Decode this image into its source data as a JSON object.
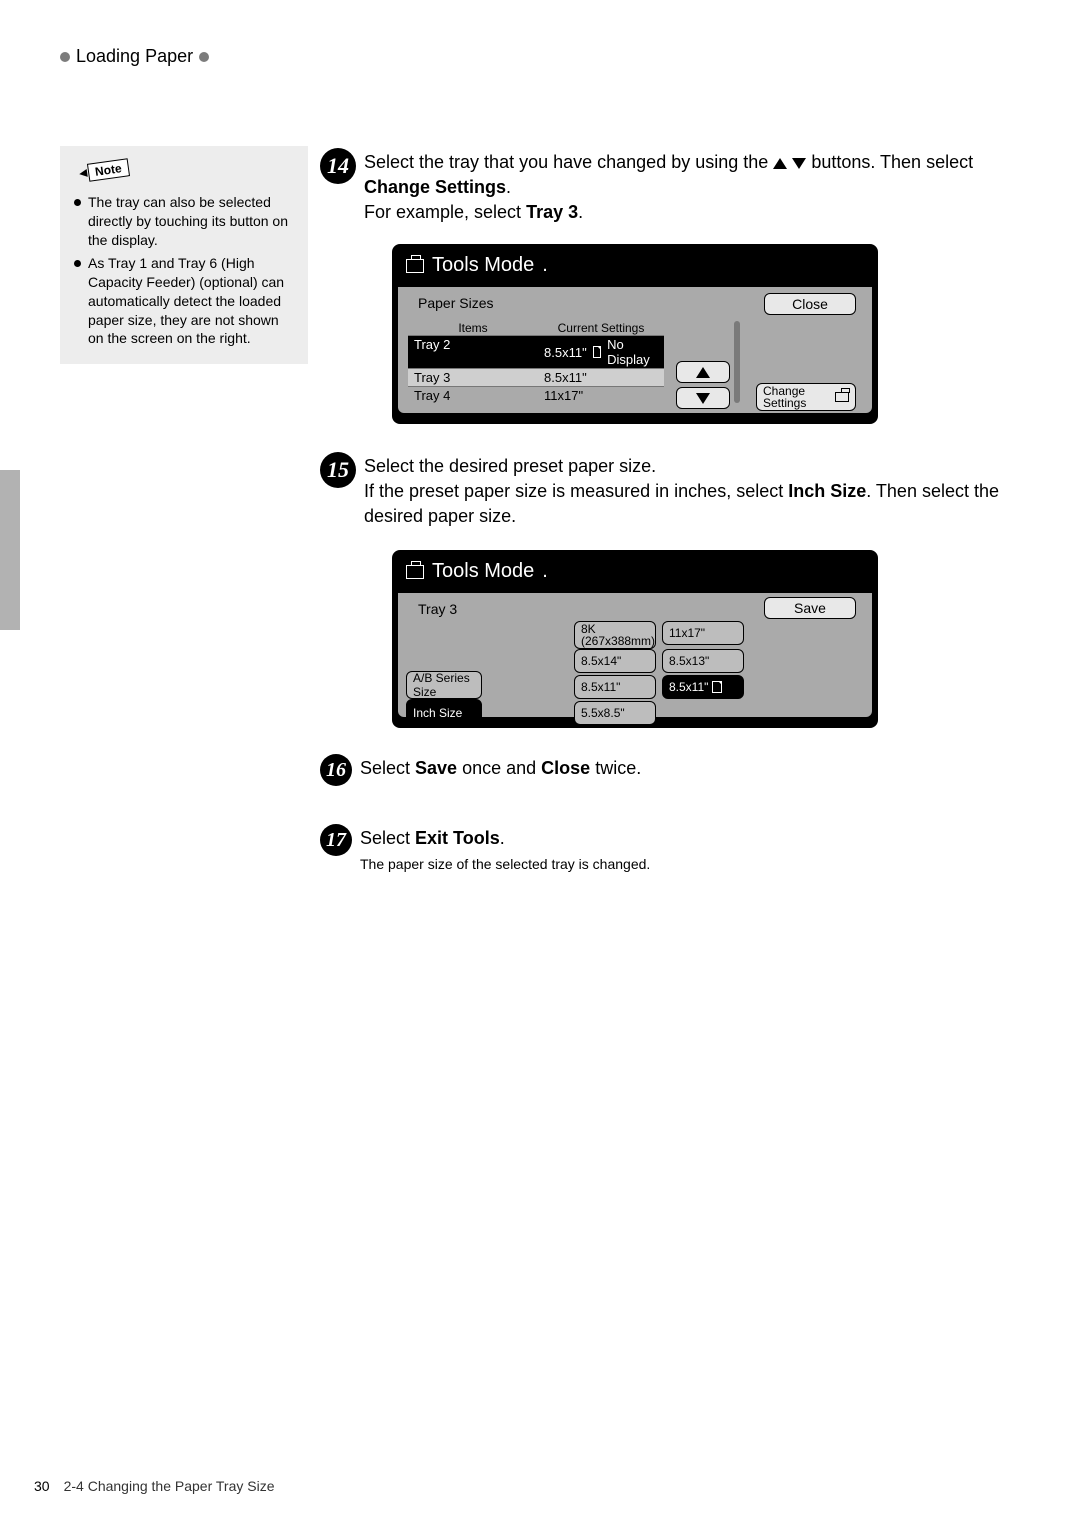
{
  "header": {
    "title": "Loading Paper"
  },
  "note": {
    "tag": "Note",
    "items": [
      "The tray can also be selected directly by touching its button on the display.",
      "As Tray 1 and Tray 6 (High Capacity Feeder) (optional) can automatically detect the loaded paper size, they are not shown on the screen on the right."
    ]
  },
  "steps": {
    "s14": {
      "num": "14",
      "t1a": "Select the tray that you have changed by using the ",
      "t1b": " buttons. Then select ",
      "bold1": "Change Settings",
      "t1c": ".",
      "t2a": "For example, select ",
      "bold2": "Tray 3",
      "t2b": "."
    },
    "s15": {
      "num": "15",
      "t1": "Select the desired preset paper size.",
      "t2a": "If the preset paper size is measured in inches, select ",
      "bold1": "Inch Size",
      "t2b": ". Then select the desired paper size."
    },
    "s16": {
      "num": "16",
      "ta": "Select ",
      "b1": "Save",
      "tb": " once and ",
      "b2": "Close",
      "tc": " twice."
    },
    "s17": {
      "num": "17",
      "ta": "Select ",
      "b1": "Exit Tools",
      "tb": ".",
      "sub": "The paper size of the selected tray is changed."
    }
  },
  "screen1": {
    "title": "Tools Mode",
    "panel_label": "Paper Sizes",
    "close": "Close",
    "headers": {
      "c1": "Items",
      "c2": "Current Settings"
    },
    "rows": [
      {
        "c1": "Tray 2",
        "c2a": "8.5x11\"",
        "c2b": "No Display"
      },
      {
        "c1": "Tray 3",
        "c2a": "8.5x11\"",
        "c2b": ""
      },
      {
        "c1": "Tray 4",
        "c2a": "11x17\"",
        "c2b": ""
      }
    ],
    "change": "Change Settings"
  },
  "screen2": {
    "title": "Tools Mode",
    "panel_label": "Tray 3",
    "save": "Save",
    "group_ab": "A/B Series Size",
    "group_inch": "Inch Size",
    "opts": {
      "o1a": "8K",
      "o1b": "(267x388mm)",
      "o2": "11x17\"",
      "o3": "8.5x14\"",
      "o4": "8.5x13\"",
      "o5": "8.5x11\"",
      "o6": "8.5x11\"",
      "o7": "5.5x8.5\""
    }
  },
  "footer": {
    "page": "30",
    "section": "2-4 Changing the Paper Tray Size"
  }
}
